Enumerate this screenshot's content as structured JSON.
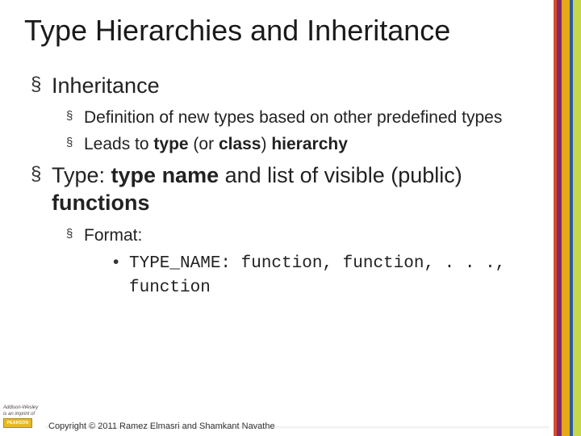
{
  "title": "Type Hierarchies and Inheritance",
  "bullets": {
    "b1": {
      "text": "Inheritance"
    },
    "b1_1": {
      "text": "Definition of new types based on other predefined types"
    },
    "b1_2": {
      "pre": "Leads to ",
      "bold1": "type",
      "mid": " (or ",
      "bold2": "class",
      "post": ") ",
      "bold3": "hierarchy"
    },
    "b2": {
      "pre": "Type: ",
      "bold1": "type name",
      "mid": " and list of visible (public) ",
      "bold2": "functions"
    },
    "b2_1": {
      "text": "Format:"
    },
    "b2_1_1": {
      "text": "TYPE_NAME: function, function, . . ., function"
    }
  },
  "footer": {
    "aw1": "Addison-Wesley",
    "aw2": "is an imprint of",
    "pearson": "PEARSON",
    "copyright": "Copyright © 2011 Ramez Elmasri and Shamkant Navathe"
  }
}
